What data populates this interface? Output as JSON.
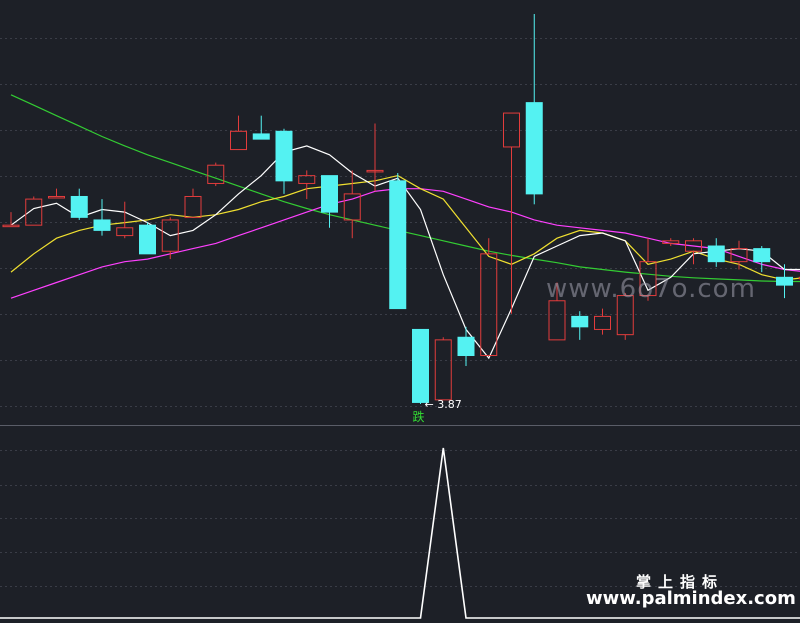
{
  "chart_data": [
    {
      "type": "candlestick",
      "colors": {
        "up": "#e23c3c",
        "down": "#54f2f2",
        "ma5": "#ffffff",
        "ma10": "#f0e030",
        "ma20": "#ff40ff",
        "ma60": "#33cc33"
      },
      "candles": [
        {
          "o": 7.3,
          "c": 7.3,
          "h": 7.55,
          "l": 7.3
        },
        {
          "o": 7.3,
          "c": 7.8,
          "h": 7.85,
          "l": 7.3
        },
        {
          "o": 7.85,
          "c": 7.85,
          "h": 8.0,
          "l": 7.85
        },
        {
          "o": 7.85,
          "c": 7.45,
          "h": 8.0,
          "l": 7.4
        },
        {
          "o": 7.4,
          "c": 7.2,
          "h": 7.8,
          "l": 7.1
        },
        {
          "o": 7.1,
          "c": 7.25,
          "h": 7.75,
          "l": 7.05
        },
        {
          "o": 7.3,
          "c": 6.75,
          "h": 7.35,
          "l": 6.75
        },
        {
          "o": 6.8,
          "c": 7.4,
          "h": 7.45,
          "l": 6.65
        },
        {
          "o": 7.45,
          "c": 7.85,
          "h": 8.0,
          "l": 7.45
        },
        {
          "o": 8.1,
          "c": 8.45,
          "h": 8.5,
          "l": 8.05
        },
        {
          "o": 8.75,
          "c": 9.1,
          "h": 9.4,
          "l": 8.75
        },
        {
          "o": 9.05,
          "c": 8.95,
          "h": 9.4,
          "l": 8.95
        },
        {
          "o": 9.1,
          "c": 8.15,
          "h": 9.15,
          "l": 7.9
        },
        {
          "o": 8.1,
          "c": 8.25,
          "h": 8.35,
          "l": 7.8
        },
        {
          "o": 8.25,
          "c": 7.55,
          "h": 8.25,
          "l": 7.25
        },
        {
          "o": 7.4,
          "c": 7.9,
          "h": 8.35,
          "l": 7.05
        },
        {
          "o": 8.35,
          "c": 8.35,
          "h": 9.25,
          "l": 7.95
        },
        {
          "o": 8.15,
          "c": 5.7,
          "h": 8.3,
          "l": 5.7
        },
        {
          "o": 5.3,
          "c": 3.9,
          "h": 5.3,
          "l": 3.87
        },
        {
          "o": 3.95,
          "c": 5.1,
          "h": 5.15,
          "l": 3.95
        },
        {
          "o": 5.15,
          "c": 4.8,
          "h": 5.35,
          "l": 4.6
        },
        {
          "o": 4.8,
          "c": 6.75,
          "h": 7.05,
          "l": 4.8
        },
        {
          "o": 8.8,
          "c": 9.45,
          "h": 9.45,
          "l": 5.6
        },
        {
          "o": 9.65,
          "c": 7.9,
          "h": 11.35,
          "l": 7.7
        },
        {
          "o": 5.1,
          "c": 5.85,
          "h": 6.2,
          "l": 5.1
        },
        {
          "o": 5.55,
          "c": 5.35,
          "h": 5.65,
          "l": 5.1
        },
        {
          "o": 5.3,
          "c": 5.55,
          "h": 5.7,
          "l": 5.2
        },
        {
          "o": 5.2,
          "c": 5.95,
          "h": 6.0,
          "l": 5.1
        },
        {
          "o": 5.95,
          "c": 6.6,
          "h": 7.05,
          "l": 5.85
        },
        {
          "o": 6.95,
          "c": 7.0,
          "h": 7.05,
          "l": 6.9
        },
        {
          "o": 6.8,
          "c": 7.0,
          "h": 7.05,
          "l": 6.55
        },
        {
          "o": 6.9,
          "c": 6.6,
          "h": 7.05,
          "l": 6.5
        },
        {
          "o": 6.6,
          "c": 6.85,
          "h": 7.0,
          "l": 6.45
        },
        {
          "o": 6.85,
          "c": 6.6,
          "h": 6.9,
          "l": 6.4
        },
        {
          "o": 6.3,
          "c": 6.15,
          "h": 6.55,
          "l": 5.9
        },
        {
          "o": 6.3,
          "c": 6.3,
          "h": 6.4,
          "l": 6.15
        },
        {
          "o": 6.3,
          "c": 6.2,
          "h": 6.45,
          "l": 6.15
        }
      ],
      "ma5": [
        7.3,
        7.62,
        7.72,
        7.45,
        7.6,
        7.55,
        7.35,
        7.1,
        7.2,
        7.5,
        7.9,
        8.25,
        8.7,
        8.82,
        8.65,
        8.3,
        8.05,
        8.2,
        7.6,
        6.35,
        5.3,
        4.75,
        5.7,
        6.7,
        6.9,
        7.1,
        7.15,
        7.0,
        6.05,
        6.3,
        6.75,
        6.8,
        6.85,
        6.8,
        6.45,
        6.45,
        6.25
      ],
      "ma10": [
        6.4,
        6.75,
        7.05,
        7.2,
        7.3,
        7.35,
        7.4,
        7.5,
        7.45,
        7.5,
        7.6,
        7.75,
        7.85,
        8.0,
        8.05,
        8.1,
        8.15,
        8.25,
        8.0,
        7.8,
        7.25,
        6.7,
        6.55,
        6.75,
        7.05,
        7.2,
        7.15,
        7.0,
        6.55,
        6.65,
        6.8,
        6.65,
        6.55,
        6.35,
        6.25,
        6.3,
        6.35
      ],
      "ma20": [
        5.9,
        6.05,
        6.2,
        6.35,
        6.5,
        6.6,
        6.65,
        6.75,
        6.85,
        6.95,
        7.1,
        7.25,
        7.4,
        7.55,
        7.7,
        7.8,
        7.95,
        8.0,
        8.0,
        7.95,
        7.8,
        7.65,
        7.55,
        7.4,
        7.3,
        7.25,
        7.2,
        7.15,
        7.05,
        6.95,
        6.9,
        6.85,
        6.7,
        6.55,
        6.45,
        6.4,
        6.35
      ],
      "ma60": [
        9.8,
        9.6,
        9.4,
        9.2,
        9.0,
        8.82,
        8.65,
        8.5,
        8.35,
        8.2,
        8.05,
        7.9,
        7.75,
        7.62,
        7.5,
        7.4,
        7.3,
        7.2,
        7.1,
        7.0,
        6.9,
        6.8,
        6.72,
        6.65,
        6.58,
        6.5,
        6.45,
        6.4,
        6.36,
        6.32,
        6.29,
        6.27,
        6.25,
        6.23,
        6.22,
        6.22,
        6.22
      ],
      "low_label": "3.87",
      "signal_label": "跌",
      "signal_index": 18
    },
    {
      "type": "line",
      "x_count": 37,
      "values": [
        0,
        0,
        0,
        0,
        0,
        0,
        0,
        0,
        0,
        0,
        0,
        0,
        0,
        0,
        0,
        0,
        0,
        0,
        0,
        1,
        0,
        0,
        0,
        0,
        0,
        0,
        0,
        0,
        0,
        0,
        0,
        0,
        0,
        0,
        0,
        0,
        0
      ],
      "ylim": [
        0,
        1
      ]
    }
  ],
  "watermarks": {
    "center": "www.6o7o.com",
    "brand_cn": "掌上指标",
    "brand_url": "www.palmindex.com"
  }
}
